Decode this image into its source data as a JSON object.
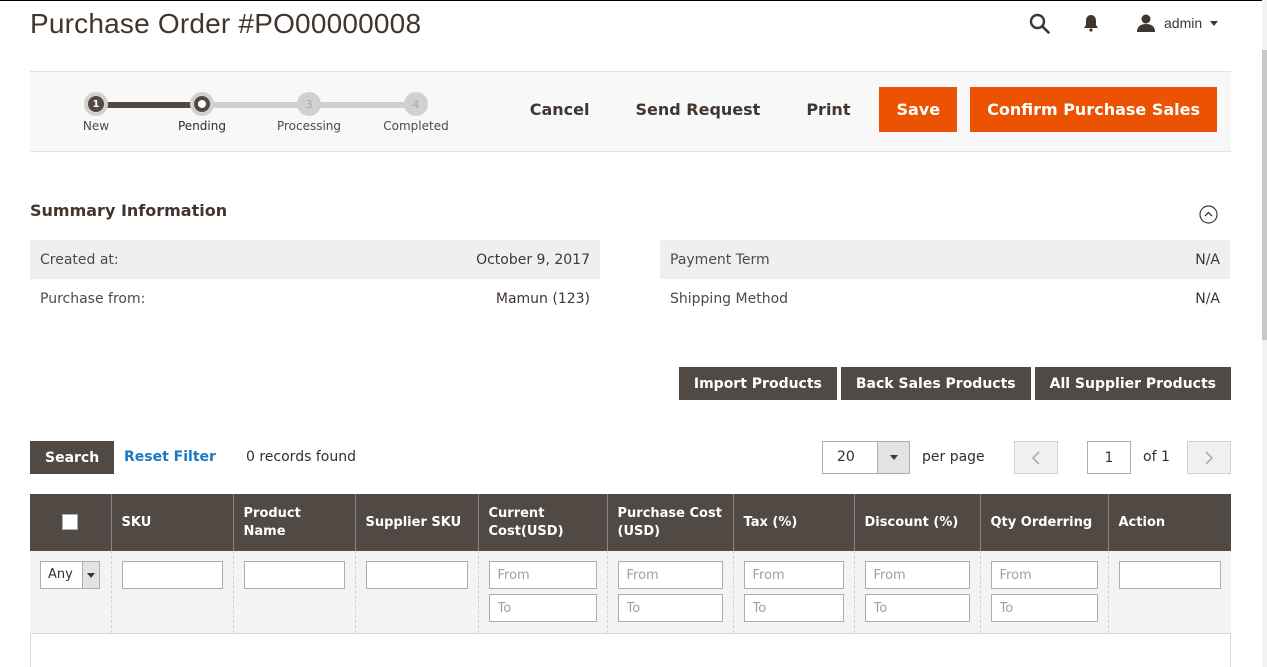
{
  "header": {
    "title": "Purchase Order #PO00000008",
    "user": "admin",
    "icons": [
      "search-icon",
      "bell-icon",
      "user-icon"
    ]
  },
  "progress": {
    "current_step": 2,
    "steps": [
      {
        "number": "1",
        "label": "New",
        "state": "done"
      },
      {
        "number": "2",
        "label": "Pending",
        "state": "current"
      },
      {
        "number": "3",
        "label": "Processing",
        "state": "todo"
      },
      {
        "number": "4",
        "label": "Completed",
        "state": "todo"
      }
    ]
  },
  "actions": {
    "cancel": "Cancel",
    "send_request": "Send Request",
    "print": "Print",
    "save": "Save",
    "confirm": "Confirm Purchase Sales"
  },
  "summary": {
    "title": "Summary Information",
    "left": [
      {
        "label": "Created at:",
        "value": "October 9, 2017"
      },
      {
        "label": "Purchase from:",
        "value": "Mamun (123)"
      }
    ],
    "right": [
      {
        "label": "Payment Term",
        "value": "N/A"
      },
      {
        "label": "Shipping Method",
        "value": "N/A"
      }
    ]
  },
  "grid_actions": {
    "import": "Import Products",
    "back_sales": "Back Sales Products",
    "all_supplier": "All Supplier Products"
  },
  "toolbar": {
    "search": "Search",
    "reset": "Reset Filter",
    "records": "0 records found",
    "per_page_value": "20",
    "per_page_label": "per page",
    "page_value": "1",
    "of_label": "of 1"
  },
  "grid": {
    "columns": [
      "",
      "SKU",
      "Product Name",
      "Supplier SKU",
      "Current Cost(USD)",
      "Purchase Cost (USD)",
      "Tax (%)",
      "Discount (%)",
      "Qty Orderring",
      "Action"
    ],
    "filters": {
      "select_value": "Any",
      "from_placeholder": "From",
      "to_placeholder": "To"
    },
    "rows": []
  },
  "colors": {
    "accent": "#eb5202",
    "dark": "#514943",
    "link": "#1979c3"
  }
}
